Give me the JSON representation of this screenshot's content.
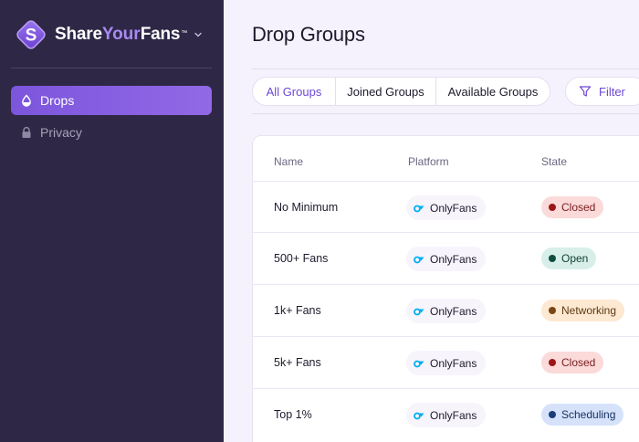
{
  "brand": {
    "name_part1": "Share",
    "name_part2": "Your",
    "name_part3": "Fans",
    "trademark": "™",
    "logo_letter": "S"
  },
  "sidebar": {
    "items": [
      {
        "label": "Drops",
        "icon": "drop-icon",
        "active": true
      },
      {
        "label": "Privacy",
        "icon": "lock-icon",
        "active": false
      }
    ]
  },
  "main": {
    "title": "Drop Groups",
    "tabs": [
      {
        "label": "All Groups",
        "active": true
      },
      {
        "label": "Joined Groups",
        "active": false
      },
      {
        "label": "Available Groups",
        "active": false
      }
    ],
    "filter_label": "Filter",
    "table": {
      "headers": [
        "Name",
        "Platform",
        "State"
      ],
      "rows": [
        {
          "name": "No Minimum",
          "platform": "OnlyFans",
          "state": "Closed"
        },
        {
          "name": "500+ Fans",
          "platform": "OnlyFans",
          "state": "Open"
        },
        {
          "name": "1k+ Fans",
          "platform": "OnlyFans",
          "state": "Networking"
        },
        {
          "name": "5k+ Fans",
          "platform": "OnlyFans",
          "state": "Closed"
        },
        {
          "name": "Top 1%",
          "platform": "OnlyFans",
          "state": "Scheduling"
        }
      ]
    }
  },
  "colors": {
    "sidebar_bg": "#2e2846",
    "accent": "#7c55dc",
    "brand_accent": "#a88af2",
    "page_bg": "#f5f2fd",
    "onlyfans_blue": "#00aeef"
  }
}
